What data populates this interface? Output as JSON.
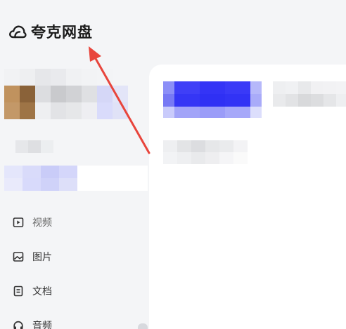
{
  "app": {
    "title": "夸克网盘",
    "logo_icon": "cloud-icon"
  },
  "sidebar": {
    "items": [
      {
        "label": "视频",
        "icon": "video-play-icon"
      },
      {
        "label": "图片",
        "icon": "image-icon"
      },
      {
        "label": "文档",
        "icon": "document-icon"
      },
      {
        "label": "音频",
        "icon": "headphones-icon"
      }
    ]
  },
  "annotation": {
    "arrow_color": "#e8453c"
  }
}
